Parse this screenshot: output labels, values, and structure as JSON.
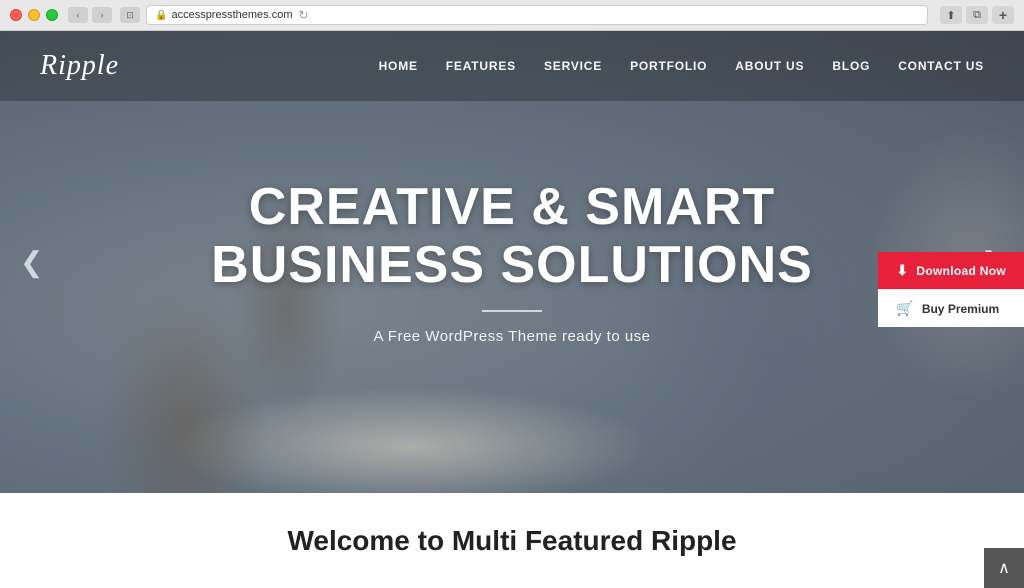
{
  "browser": {
    "url": "accesspressthemes.com",
    "back_label": "‹",
    "forward_label": "›",
    "window_label": "⊡",
    "refresh_label": "↻",
    "share_label": "⬆",
    "tab_label": "⧉",
    "plus_label": "+"
  },
  "header": {
    "logo": "Ripple",
    "nav": [
      {
        "label": "HOME"
      },
      {
        "label": "FEATURES"
      },
      {
        "label": "SERVICE"
      },
      {
        "label": "PORTFOLIO"
      },
      {
        "label": "ABOUT US"
      },
      {
        "label": "BLOG"
      },
      {
        "label": "CONTACT US"
      }
    ]
  },
  "hero": {
    "title_line1": "CREATIVE & SMART",
    "title_line2": "BUSINESS SOLUTIONS",
    "subtitle": "A Free WordPress Theme ready to use",
    "arrow_left": "❮",
    "arrow_right": "❯"
  },
  "cta": {
    "download_label": "Download Now",
    "premium_label": "Buy Premium",
    "download_icon": "⬇",
    "cart_icon": "🛒"
  },
  "welcome": {
    "title": "Welcome to Multi Featured Ripple"
  },
  "scroll_top": "∧"
}
